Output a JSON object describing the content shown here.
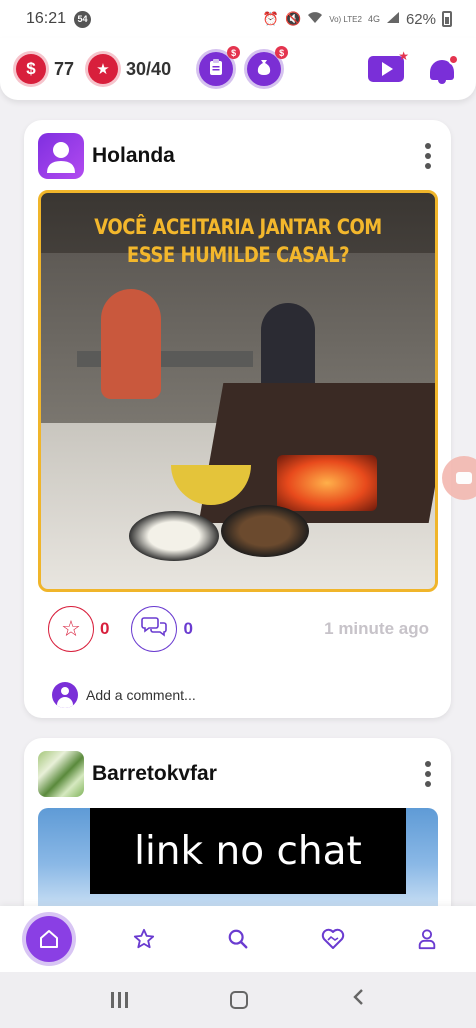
{
  "status_bar": {
    "time": "16:21",
    "notification_count": "54",
    "network_label": "Vo) LTE2",
    "network_type": "4G",
    "battery_percent": "62%"
  },
  "header": {
    "coins": "77",
    "stars": "30/40",
    "coin_symbol": "$",
    "mini_symbol": "$"
  },
  "posts": [
    {
      "username": "Holanda",
      "image_caption_line1": "VOCÊ ACEITARIA JANTAR COM",
      "image_caption_line2": "ESSE HUMILDE CASAL?",
      "likes": "0",
      "comments": "0",
      "time_ago": "1 minute ago",
      "comment_placeholder": "Add a comment..."
    },
    {
      "username": "Barretokvfar",
      "image_text": "link no chat"
    }
  ],
  "icons": {
    "home": "home-icon",
    "favorites": "star-icon",
    "search": "search-icon",
    "match": "heart-handshake-icon",
    "profile": "user-icon"
  },
  "colors": {
    "accent_purple": "#7a2fd8",
    "accent_red": "#d81f3c",
    "caption_yellow": "#f3b72c",
    "timestamp_gray": "#c7c3c9"
  }
}
